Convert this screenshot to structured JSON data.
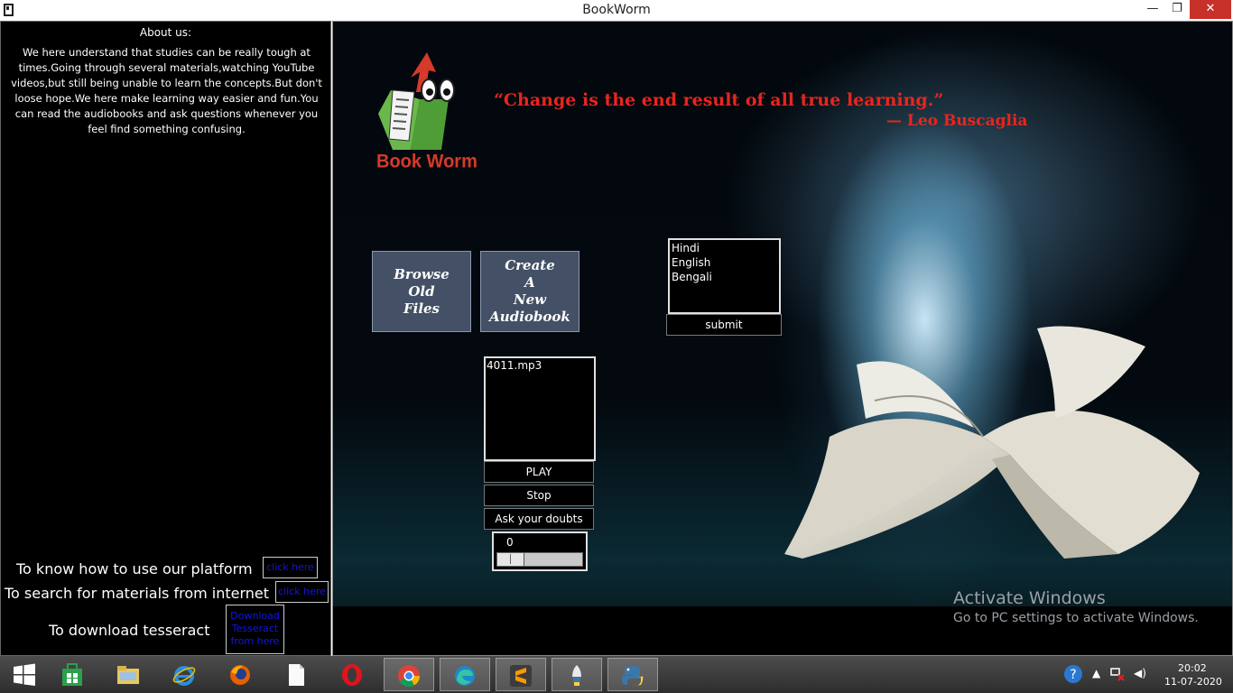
{
  "window": {
    "title": "BookWorm",
    "minimize": "—",
    "maximize": "❐",
    "close": "✕"
  },
  "sidebar": {
    "about_title": "About us:",
    "about_text": "We here understand that studies can be really tough at times.Going through several materials,watching YouTube videos,but still being unable to learn the concepts.But don't loose hope.We here make learning way easier and fun.You can read the audiobooks and ask questions whenever you feel find something confusing.",
    "help": [
      {
        "label": "To know how to use our platform",
        "link": "click here"
      },
      {
        "label": "To search for materials from internet",
        "link": "click here"
      },
      {
        "label": "To download tesseract",
        "link": "Download Tesseract from here"
      }
    ]
  },
  "main": {
    "logo_text": "Book Worm",
    "quote": "“Change is the end result of all true learning.”",
    "author": "— Leo Buscaglia",
    "browse_button": "Browse\nOld\nFiles",
    "create_button": "Create\nA\nNew\nAudiobook",
    "languages": [
      "Hindi",
      "English",
      "Bengali"
    ],
    "submit_button": "submit",
    "files": [
      "4011.mp3"
    ],
    "play_button": "PLAY",
    "stop_button": "Stop",
    "ask_button": "Ask your doubts",
    "progress_value": "0",
    "progress_fraction": 0.0,
    "activation_title": "Activate Windows",
    "activation_text": "Go to PC settings to activate Windows."
  },
  "taskbar": {
    "apps": [
      "windows-start",
      "store",
      "file-explorer",
      "internet-explorer",
      "firefox",
      "notepad",
      "opera",
      "chrome",
      "edge",
      "sublime-text",
      "python-launcher",
      "python-idle"
    ],
    "clock_time": "20:02",
    "clock_date": "11-07-2020"
  }
}
